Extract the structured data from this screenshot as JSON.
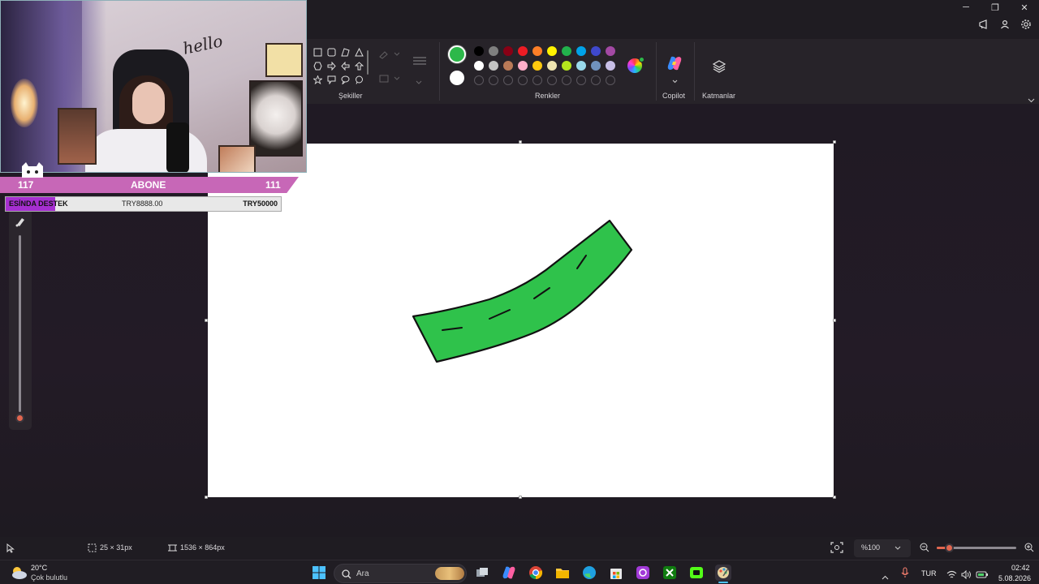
{
  "titlebar": {
    "minimize_glyph": "─",
    "restore_glyph": "❐",
    "close_glyph": "✕"
  },
  "ribbon": {
    "shapes_label": "Şekiller",
    "colors_label": "Renkler",
    "copilot_label": "Copilot",
    "layers_label": "Katmanlar",
    "active_color_primary": "#2db84a",
    "active_color_secondary": "#ffffff",
    "palette_row1": [
      "#000000",
      "#7f7f7f",
      "#880015",
      "#ed1c24",
      "#ff7f27",
      "#fff200",
      "#22b14c",
      "#00a2e8",
      "#3f48cc",
      "#a349a4"
    ],
    "palette_row2": [
      "#ffffff",
      "#c3c3c3",
      "#b97a57",
      "#ffaec9",
      "#ffc90e",
      "#efe4b0",
      "#b5e61d",
      "#99d9ea",
      "#7092be",
      "#c8bfe7"
    ]
  },
  "overlay": {
    "left_count": "117",
    "center_label": "ABONE",
    "right_count": "111",
    "support_label": "ESİNDA DESTEK",
    "support_current": "TRY8888.00",
    "support_goal": "TRY50000",
    "support_progress_percent": 18,
    "webcam_text": "hello"
  },
  "status": {
    "selection_size": "25 × 31px",
    "canvas_size": "1536 × 864px",
    "zoom": "%100",
    "zoom_slider_percent": 15
  },
  "drawing": {
    "fill_color": "#2fc24b",
    "stroke_color": "#111111"
  },
  "taskbar": {
    "weather_temp": "20°C",
    "weather_desc": "Çok bulutlu",
    "search_placeholder": "Ara",
    "language": "TUR",
    "time": "02:42",
    "date": "5.08.2026"
  }
}
